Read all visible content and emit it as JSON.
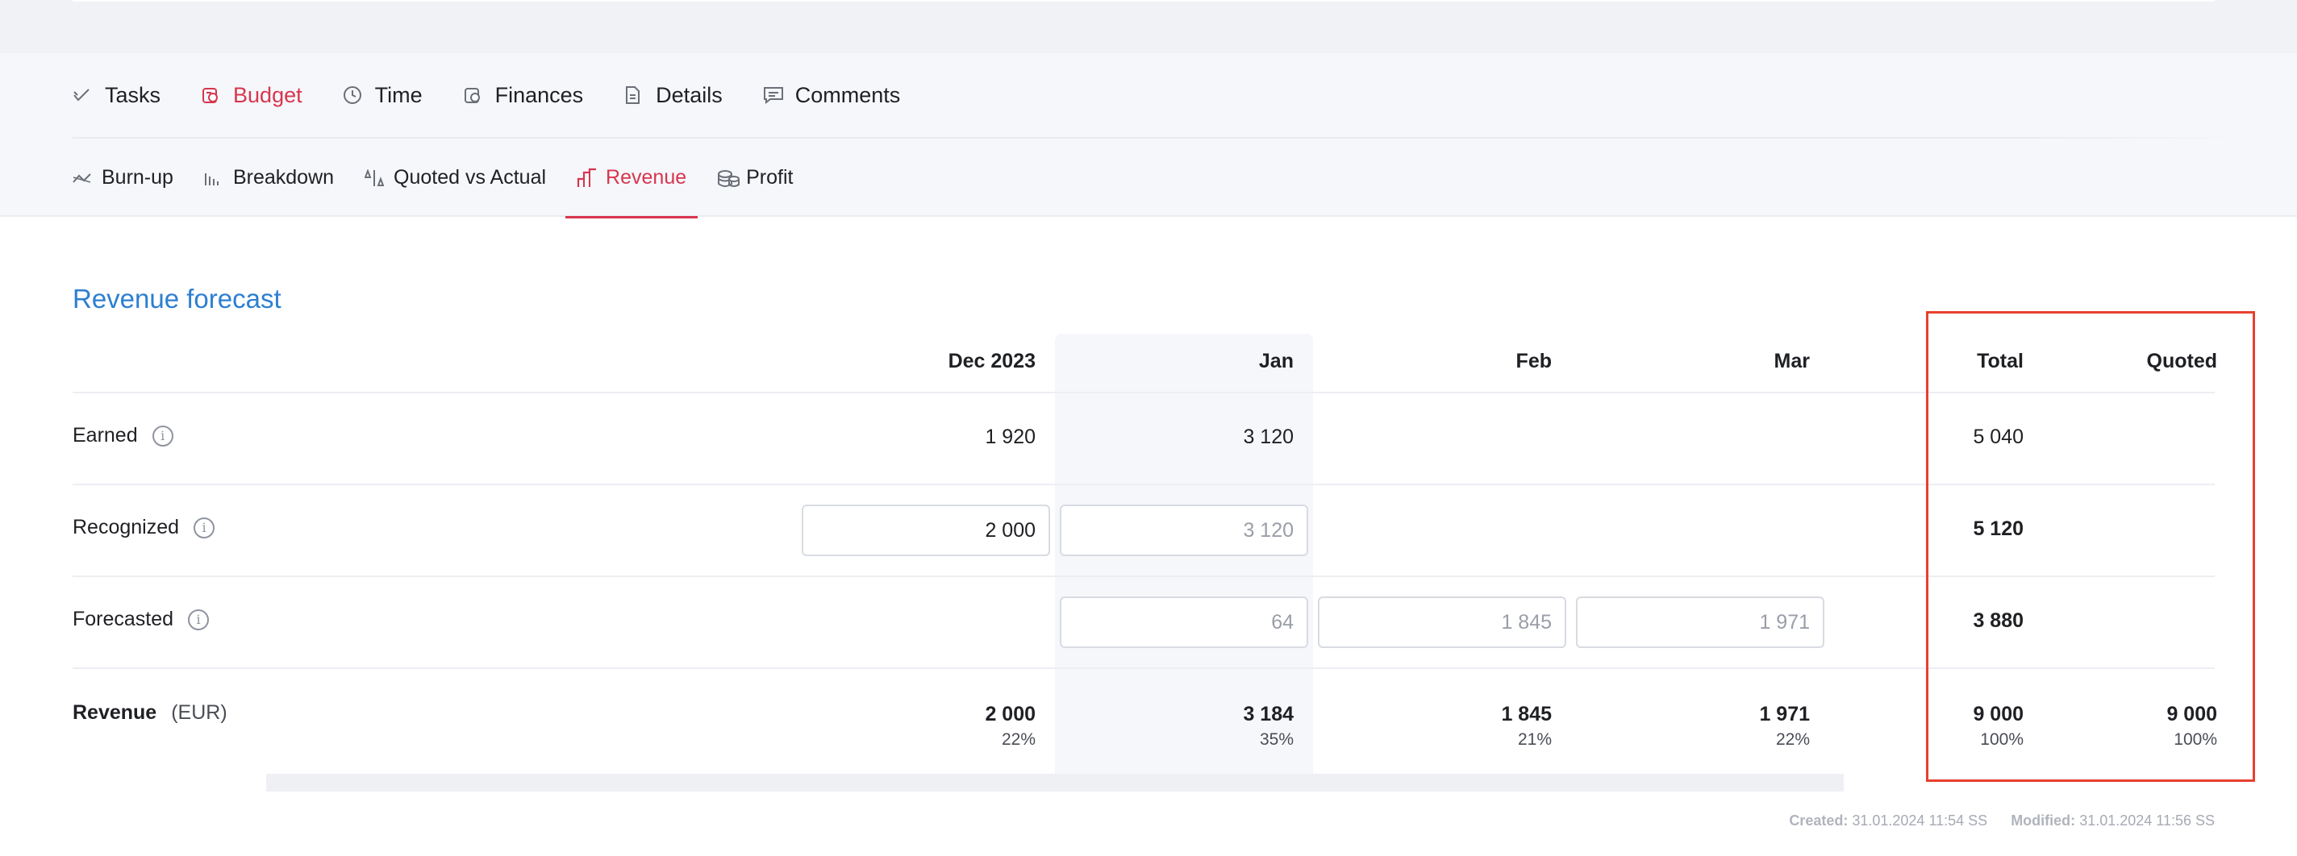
{
  "tabs": [
    {
      "label": "Tasks",
      "icon": "tasks-check-icon",
      "active": false
    },
    {
      "label": "Budget",
      "icon": "budget-icon",
      "active": true
    },
    {
      "label": "Time",
      "icon": "clock-icon",
      "active": false
    },
    {
      "label": "Finances",
      "icon": "finances-icon",
      "active": false
    },
    {
      "label": "Details",
      "icon": "document-icon",
      "active": false
    },
    {
      "label": "Comments",
      "icon": "comment-icon",
      "active": false
    }
  ],
  "subtabs": [
    {
      "label": "Burn-up",
      "icon": "burnup-icon",
      "active": false
    },
    {
      "label": "Breakdown",
      "icon": "bar-chart-icon",
      "active": false
    },
    {
      "label": "Quoted vs Actual",
      "icon": "compare-icon",
      "active": false
    },
    {
      "label": "Revenue",
      "icon": "revenue-icon",
      "active": true
    },
    {
      "label": "Profit",
      "icon": "coins-icon",
      "active": false
    }
  ],
  "section": {
    "title": "Revenue forecast"
  },
  "table": {
    "headers": {
      "dec": "Dec 2023",
      "jan": "Jan",
      "feb": "Feb",
      "mar": "Mar",
      "total": "Total",
      "quoted": "Quoted"
    },
    "earned": {
      "label": "Earned",
      "dec": "1 920",
      "jan": "3 120",
      "total": "5 040"
    },
    "recognized": {
      "label": "Recognized",
      "dec_value": "2 000",
      "jan_placeholder": "3 120",
      "total": "5 120"
    },
    "forecasted": {
      "label": "Forecasted",
      "jan_placeholder": "64",
      "feb_placeholder": "1 845",
      "mar_placeholder": "1 971",
      "total": "3 880"
    },
    "revenue": {
      "label": "Revenue",
      "unit": "(EUR)",
      "dec": "2 000",
      "dec_pct": "22%",
      "jan": "3 184",
      "jan_pct": "35%",
      "feb": "1 845",
      "feb_pct": "21%",
      "mar": "1 971",
      "mar_pct": "22%",
      "total": "9 000",
      "total_pct": "100%",
      "quoted": "9 000",
      "quoted_pct": "100%"
    }
  },
  "footer": {
    "created_label": "Created:",
    "created_value": "31.01.2024 11:54 SS",
    "modified_label": "Modified:",
    "modified_value": "31.01.2024 11:56 SS"
  },
  "colors": {
    "accent": "#d7364f",
    "title_blue": "#2d7fd1",
    "highlight_red": "#e8402f"
  }
}
